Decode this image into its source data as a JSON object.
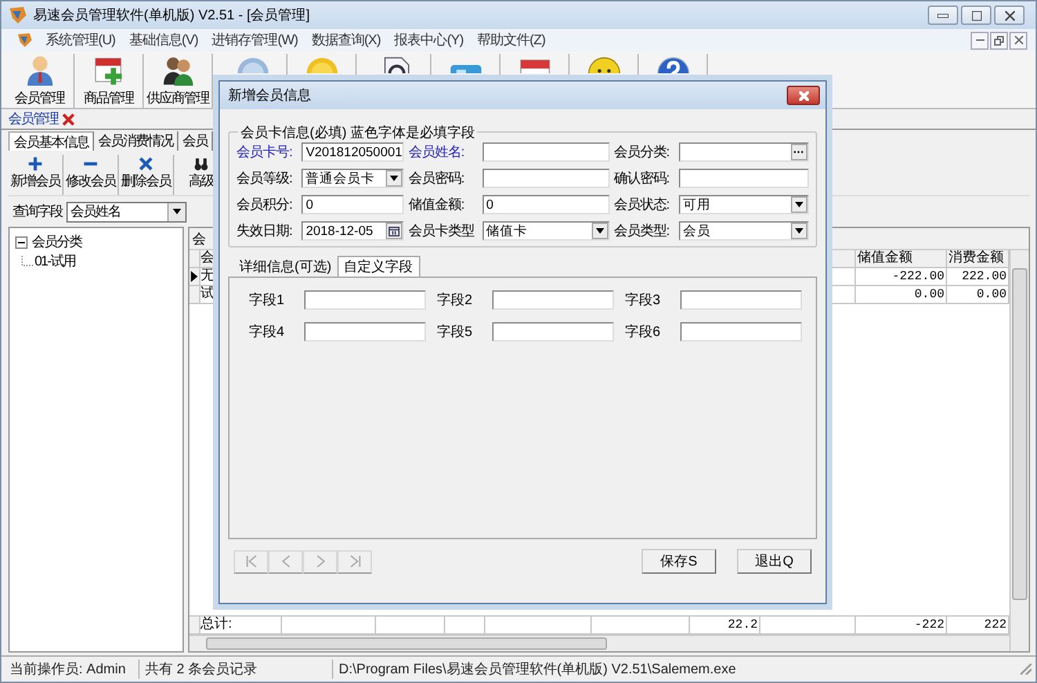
{
  "window": {
    "title": "易速会员管理软件(单机版) V2.51 - [会员管理]"
  },
  "menu": [
    "系统管理(U)",
    "基础信息(V)",
    "进销存管理(W)",
    "数据查询(X)",
    "报表中心(Y)",
    "帮助文件(Z)"
  ],
  "toolbar": [
    {
      "label": "会员管理",
      "kind": "person"
    },
    {
      "label": "商品管理",
      "kind": "calendar-add"
    },
    {
      "label": "供应商管理",
      "kind": "people"
    },
    {
      "kind": "badge"
    },
    {
      "kind": "coin"
    },
    {
      "kind": "doc-search"
    },
    {
      "kind": "card"
    },
    {
      "kind": "calendar"
    },
    {
      "kind": "smiley"
    },
    {
      "kind": "help"
    }
  ],
  "document_tab": {
    "label": "会员管理"
  },
  "tabs": [
    {
      "label": "会员基本信息",
      "selected": true
    },
    {
      "label": "会员消费情况",
      "selected": false
    },
    {
      "label": "会员",
      "selected": false
    }
  ],
  "actions": [
    {
      "label": "新增会员",
      "kind": "plus"
    },
    {
      "label": "修改会员",
      "kind": "minus"
    },
    {
      "label": "删除会员",
      "kind": "cross"
    },
    {
      "label": "高级",
      "kind": "binoculars"
    }
  ],
  "query": {
    "label": "查询字段",
    "value": "会员姓名"
  },
  "tree": [
    {
      "label": "会员分类",
      "expanded": true,
      "children": [
        {
          "label": "01-试用"
        }
      ]
    }
  ],
  "grid": {
    "caption": "会",
    "columns": [
      "会",
      "储值金额",
      "消费金额"
    ],
    "rows": [
      {
        "cells": [
          "无",
          "-222.00",
          "222.00"
        ],
        "selected": true
      },
      {
        "cells": [
          "试",
          "0.00",
          "0.00"
        ],
        "selected": false
      }
    ],
    "totals": [
      "总计:",
      "22.2",
      "-222",
      "222"
    ]
  },
  "dialog": {
    "title": "新增会员信息",
    "group_title": "会员卡信息(必填) 蓝色字体是必填字段",
    "fields": [
      {
        "label": "会员卡号:",
        "value": "V201812050001",
        "required": true,
        "kind": "text"
      },
      {
        "label": "会员姓名:",
        "required": true,
        "kind": "text"
      },
      {
        "label": "会员分类:",
        "required": false,
        "kind": "browse"
      },
      {
        "label": "会员等级:",
        "value": "普通会员卡",
        "required": false,
        "kind": "select"
      },
      {
        "label": "会员密码:",
        "required": false,
        "kind": "text"
      },
      {
        "label": "确认密码:",
        "required": false,
        "kind": "text"
      },
      {
        "label": "会员积分:",
        "value": "0",
        "required": false,
        "kind": "text"
      },
      {
        "label": "储值金额:",
        "value": "0",
        "required": false,
        "kind": "text"
      },
      {
        "label": "会员状态:",
        "value": "可用",
        "required": false,
        "kind": "select"
      },
      {
        "label": "失效日期:",
        "value": "2018-12-05",
        "required": false,
        "kind": "date"
      },
      {
        "label": "会员卡类型",
        "value": "储值卡",
        "required": false,
        "kind": "select"
      },
      {
        "label": "会员类型:",
        "value": "会员",
        "required": false,
        "kind": "select"
      }
    ],
    "tabs": [
      {
        "label": "详细信息(可选)",
        "selected": false
      },
      {
        "label": "自定义字段",
        "selected": true
      }
    ],
    "custom_fields": [
      {
        "label": "字段1"
      },
      {
        "label": "字段2"
      },
      {
        "label": "字段3"
      },
      {
        "label": "字段4"
      },
      {
        "label": "字段5"
      },
      {
        "label": "字段6"
      }
    ],
    "nav_buttons": [
      {
        "kind": "first",
        "disabled": true
      },
      {
        "kind": "prev",
        "disabled": true
      },
      {
        "kind": "next",
        "disabled": true
      },
      {
        "kind": "last",
        "disabled": true
      }
    ],
    "buttons": [
      "保存S",
      "退出Q"
    ]
  },
  "status_bar": [
    "当前操作员: Admin",
    "共有 2 条会员记录",
    "D:\\Program Files\\易速会员管理软件(单机版) V2.51\\Salemem.exe"
  ]
}
